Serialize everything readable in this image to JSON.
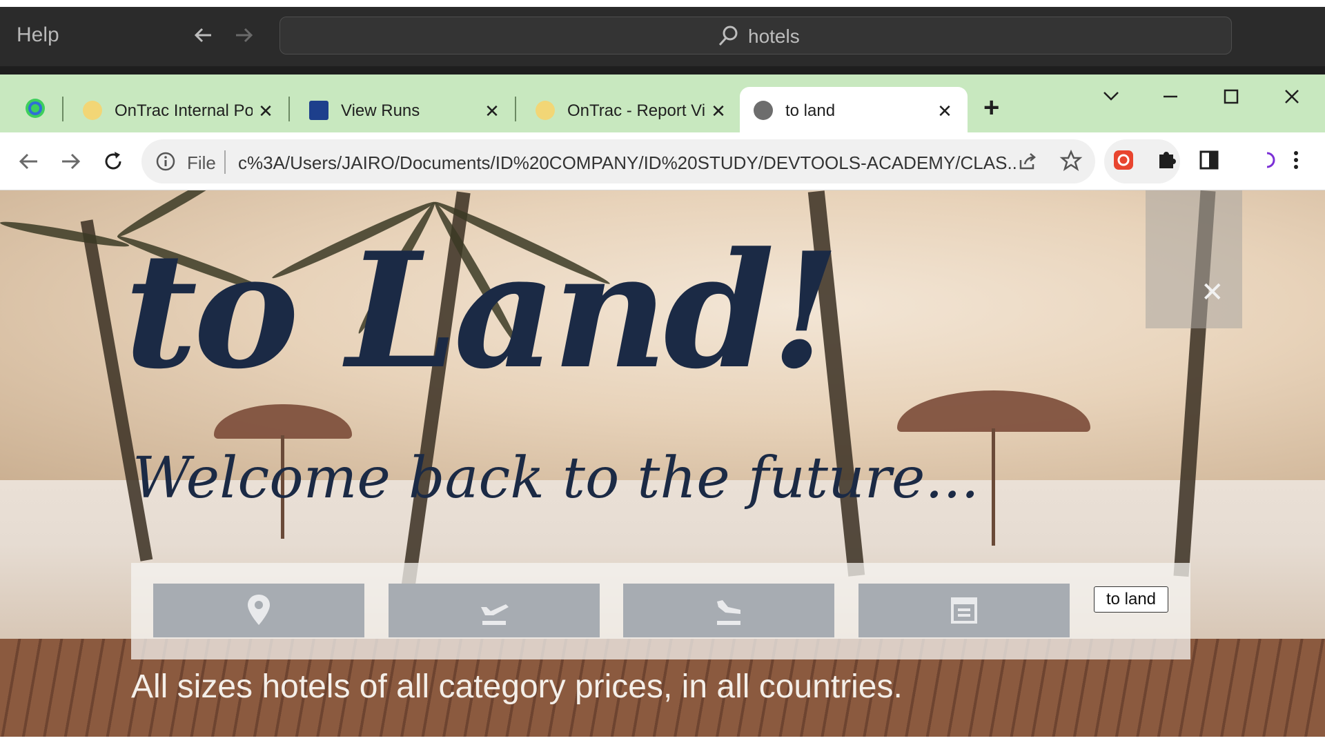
{
  "editor": {
    "menu_help": "Help",
    "search_text": "hotels"
  },
  "browser": {
    "tabs": [
      {
        "label": "OnTrac Internal Por",
        "active": false
      },
      {
        "label": "View Runs",
        "active": false
      },
      {
        "label": "OnTrac - Report Vie",
        "active": false
      },
      {
        "label": "to land",
        "active": true
      }
    ],
    "new_tab_label": "+",
    "address": {
      "scheme_label": "File",
      "url": "c%3A/Users/JAIRO/Documents/ID%20COMPANY/ID%20STUDY/DEVTOOLS-ACADEMY/CLAS..."
    }
  },
  "page": {
    "headline": "to Land!",
    "subline": "Welcome back to the future...",
    "to_land_button": "to land",
    "tagline": "All sizes hotels of all category prices, in all countries.",
    "search_buttons": [
      {
        "icon": "location-pin-icon"
      },
      {
        "icon": "plane-departure-icon"
      },
      {
        "icon": "plane-arrival-icon"
      },
      {
        "icon": "calendar-icon"
      }
    ]
  },
  "colors": {
    "headline": "#1b2a45",
    "tabstrip": "#c8e8bf",
    "button_gray": "#a7acb2"
  }
}
